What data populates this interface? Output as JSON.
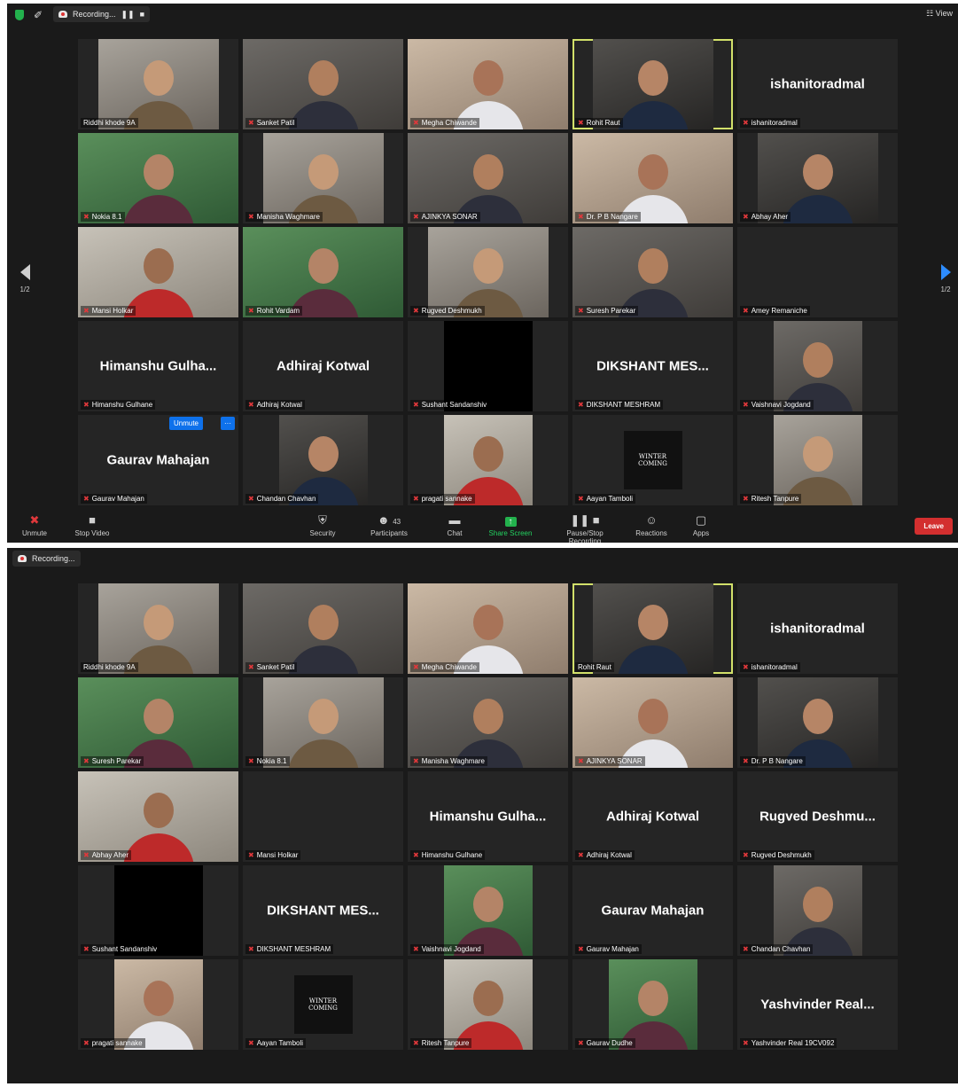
{
  "top": {
    "recording_label": "Recording...",
    "view_label": "View",
    "page_indicator": "1/2",
    "toolbar": {
      "unmute": "Unmute",
      "stop_video": "Stop Video",
      "security": "Security",
      "participants": "Participants",
      "participants_count": "43",
      "chat": "Chat",
      "share_screen": "Share Screen",
      "pause_stop_recording": "Pause/Stop Recording",
      "reactions": "Reactions",
      "apps": "Apps",
      "leave": "Leave"
    },
    "tile_buttons": {
      "unmute": "Unmute",
      "more": "···"
    },
    "tiles": [
      {
        "name": "Riddhi khode 9A",
        "type": "video",
        "muted": false
      },
      {
        "name": "Sanket Patil",
        "type": "video",
        "muted": true
      },
      {
        "name": "Megha Chiwande",
        "type": "video",
        "muted": true
      },
      {
        "name": "Rohit Raut",
        "type": "video",
        "muted": true,
        "active": true
      },
      {
        "name": "ishanitoradmal",
        "type": "name",
        "display": "ishanitoradmal",
        "muted": true
      },
      {
        "name": "Nokia 8.1",
        "type": "video",
        "muted": true
      },
      {
        "name": "Manisha Waghmare",
        "type": "video",
        "muted": true
      },
      {
        "name": "AJINKYA SONAR",
        "type": "video",
        "muted": true
      },
      {
        "name": "Dr. P B Nangare",
        "type": "video",
        "muted": true
      },
      {
        "name": "Abhay Aher",
        "type": "video",
        "muted": true
      },
      {
        "name": "Mansi Holkar",
        "type": "video",
        "muted": true
      },
      {
        "name": "Rohit Vardam",
        "type": "video",
        "muted": true
      },
      {
        "name": "Rugved Deshmukh",
        "type": "video",
        "muted": true
      },
      {
        "name": "Suresh Parekar",
        "type": "video",
        "muted": true
      },
      {
        "name": "Amey Remaniche",
        "type": "empty",
        "muted": true
      },
      {
        "name": "Himanshu Gulhane",
        "type": "name",
        "display": "Himanshu  Gulha...",
        "muted": true
      },
      {
        "name": "Adhiraj Kotwal",
        "type": "name",
        "display": "Adhiraj Kotwal",
        "muted": true
      },
      {
        "name": "Sushant Sandanshiv",
        "type": "black",
        "muted": true
      },
      {
        "name": "DIKSHANT MESHRAM",
        "type": "name",
        "display": "DIKSHANT  MES...",
        "muted": true
      },
      {
        "name": "Vaishnavi Jogdand",
        "type": "photo",
        "muted": true
      },
      {
        "name": "Gaurav Mahajan",
        "type": "name",
        "display": "Gaurav Mahajan",
        "muted": true,
        "hover": true
      },
      {
        "name": "Chandan Chavhan",
        "type": "photo",
        "muted": true
      },
      {
        "name": "pragati sannake",
        "type": "photo",
        "muted": true
      },
      {
        "name": "Aayan Tamboli",
        "type": "wolf",
        "muted": true
      },
      {
        "name": "Ritesh Tanpure",
        "type": "photo",
        "muted": true
      }
    ]
  },
  "bottom": {
    "recording_label": "Recording...",
    "wolf_text": "WINTER COMING",
    "tiles": [
      {
        "name": "Riddhi khode 9A",
        "type": "video",
        "muted": false
      },
      {
        "name": "Sanket Patil",
        "type": "video",
        "muted": true
      },
      {
        "name": "Megha Chiwande",
        "type": "video",
        "muted": true
      },
      {
        "name": "Rohit Raut",
        "type": "video",
        "muted": false,
        "active": true
      },
      {
        "name": "ishanitoradmal",
        "type": "name",
        "display": "ishanitoradmal",
        "muted": true
      },
      {
        "name": "Suresh Parekar",
        "type": "video",
        "muted": true
      },
      {
        "name": "Nokia 8.1",
        "type": "video",
        "muted": true
      },
      {
        "name": "Manisha Waghmare",
        "type": "video",
        "muted": true
      },
      {
        "name": "AJINKYA SONAR",
        "type": "video",
        "muted": true
      },
      {
        "name": "Dr. P B Nangare",
        "type": "video",
        "muted": true
      },
      {
        "name": "Abhay Aher",
        "type": "video",
        "muted": true
      },
      {
        "name": "Mansi Holkar",
        "type": "empty",
        "muted": true
      },
      {
        "name": "Himanshu Gulhane",
        "type": "name",
        "display": "Himanshu  Gulha...",
        "muted": true
      },
      {
        "name": "Adhiraj Kotwal",
        "type": "name",
        "display": "Adhiraj Kotwal",
        "muted": true
      },
      {
        "name": "Rugved Deshmukh",
        "type": "name",
        "display": "Rugved  Deshmu...",
        "muted": true
      },
      {
        "name": "Sushant Sandanshiv",
        "type": "black",
        "muted": true
      },
      {
        "name": "DIKSHANT MESHRAM",
        "type": "name",
        "display": "DIKSHANT  MES...",
        "muted": true
      },
      {
        "name": "Vaishnavi Jogdand",
        "type": "photo",
        "muted": true
      },
      {
        "name": "Gaurav Mahajan",
        "type": "name",
        "display": "Gaurav Mahajan",
        "muted": true
      },
      {
        "name": "Chandan Chavhan",
        "type": "photo",
        "muted": true
      },
      {
        "name": "pragati sannake",
        "type": "photo",
        "muted": true
      },
      {
        "name": "Aayan Tamboli",
        "type": "wolf",
        "muted": true
      },
      {
        "name": "Ritesh Tanpure",
        "type": "photo",
        "muted": true
      },
      {
        "name": "Gaurav Dudhe",
        "type": "photo",
        "muted": true
      },
      {
        "name": "Yashvinder Real 19CV092",
        "type": "name",
        "display": "Yashvinder  Real...",
        "muted": true
      }
    ]
  },
  "colors": {
    "active_border": "#d2e06a",
    "leave": "#d32f2f",
    "share_green": "#23b14d",
    "unmute_blue": "#0e71eb"
  }
}
